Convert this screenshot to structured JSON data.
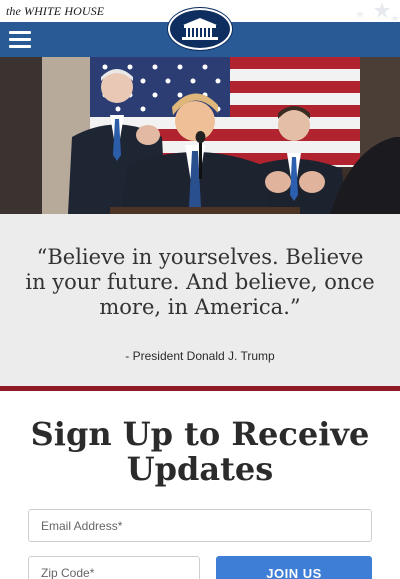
{
  "header": {
    "brand": "the WHITE HOUSE",
    "menu_icon": "hamburger-menu-icon",
    "seal_icon": "white-house-seal-icon",
    "nav_color": "#2a5a96"
  },
  "hero": {
    "image": "photo-president-at-podium"
  },
  "quote": {
    "text": "“Believe in yourselves. Believe in your future. And believe, once more, in America.”",
    "attribution": "- President Donald J. Trump"
  },
  "signup": {
    "title": "Sign Up to Receive Updates",
    "email_placeholder": "Email Address*",
    "zip_placeholder": "Zip Code*",
    "join_label": "JOIN US",
    "accent": "#3f7ed6",
    "rule_color": "#8e1a24"
  }
}
